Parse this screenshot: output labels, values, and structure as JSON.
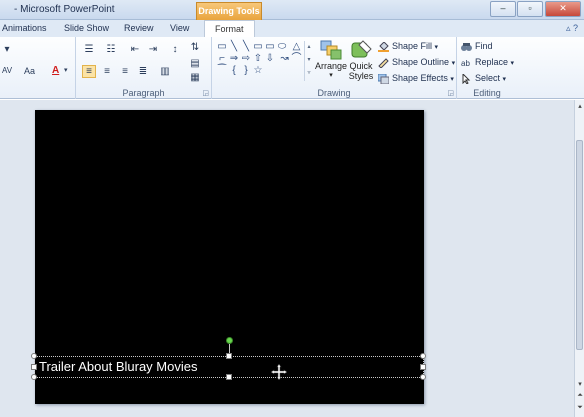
{
  "window": {
    "title": "- Microsoft PowerPoint",
    "context_tab": "Drawing Tools",
    "min_glyph": "–",
    "max_glyph": "▫",
    "close_glyph": "✕"
  },
  "tabs": [
    {
      "label": "Animations"
    },
    {
      "label": "Slide Show"
    },
    {
      "label": "Review"
    },
    {
      "label": "View"
    },
    {
      "label": "Format"
    }
  ],
  "ribbon_controls": "▵ ?",
  "groups": {
    "paragraph": {
      "label": "Paragraph"
    },
    "drawing": {
      "label": "Drawing",
      "arrange": "Arrange",
      "quick_styles_1": "Quick",
      "quick_styles_2": "Styles",
      "shape_fill": "Shape Fill",
      "shape_outline": "Shape Outline",
      "shape_effects": "Shape Effects"
    },
    "editing": {
      "label": "Editing",
      "find": "Find",
      "replace": "Replace",
      "select": "Select"
    }
  },
  "font_controls": {
    "char_spacing": "AV",
    "change_case": "Aa",
    "font_color": "A"
  },
  "shapes": [
    "▭",
    "╲",
    "╲",
    "▭",
    "▭",
    "⬭",
    "△",
    "⌐",
    "⇒",
    "⇨",
    "⇧",
    "⇩",
    "↝",
    "⌒",
    "⁀",
    "{",
    "}",
    "☆"
  ],
  "slide": {
    "text": "Trailer About Bluray Movies"
  },
  "colors": {
    "context_tab": "#e9a43d",
    "ribbon_bg": "#e9f0f9",
    "workspace": "#dfe6ef",
    "slide_bg": "#000000",
    "rotation_handle": "#68d64e"
  }
}
